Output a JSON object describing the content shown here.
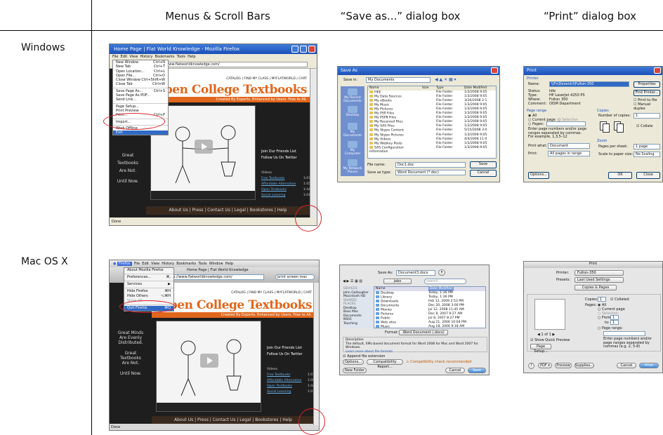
{
  "columns": {
    "menus": "Menus & Scroll Bars",
    "save": "“Save as...” dialog box",
    "print": "“Print” dialog box"
  },
  "rows": {
    "windows": "Windows",
    "mac": "Mac OS X"
  },
  "win_firefox": {
    "title": "Home Page | Flat World Knowledge - Mozilla Firefox",
    "menubar": [
      "File",
      "Edit",
      "View",
      "History",
      "Bookmarks",
      "Tools",
      "Help"
    ],
    "url": "http://www.flatworldknowledge.com/",
    "file_menu": [
      {
        "label": "New Window",
        "key": "Ctrl+N"
      },
      {
        "label": "New Tab",
        "key": "Ctrl+T"
      },
      {
        "label": "Open Location...",
        "key": "Ctrl+L"
      },
      {
        "label": "Open File...",
        "key": "Ctrl+O"
      },
      {
        "label": "Close Window",
        "key": "Ctrl+Shift+W"
      },
      {
        "label": "Close Tab",
        "key": "Ctrl+W"
      },
      {
        "label": "Save Page As...",
        "key": "Ctrl+S"
      },
      {
        "label": "Save Page As PDF...",
        "key": ""
      },
      {
        "label": "Send Link...",
        "key": ""
      },
      {
        "label": "Page Setup...",
        "key": ""
      },
      {
        "label": "Print Preview",
        "key": ""
      },
      {
        "label": "Print...",
        "key": "Ctrl+P"
      },
      {
        "label": "Import...",
        "key": ""
      },
      {
        "label": "Work Offline",
        "key": ""
      },
      {
        "label": "Exit",
        "key": ""
      }
    ],
    "nav_links": "CATALOG | FIND MY CLASS | MYFLATWORLD | CART",
    "site_title": "Open College Textbooks",
    "tagline": "Created By Experts. Enhanced by Users. Free to All.",
    "left_text": [
      "Great",
      "Textbooks",
      "Are Not.",
      "Until Now."
    ],
    "friends": [
      "Join Our Friends List",
      "Follow Us On Twitter"
    ],
    "videos_heading": "Videos",
    "videos": [
      {
        "title": "Free Textbooks",
        "time": "1:07"
      },
      {
        "title": "Affordable Alternative",
        "time": "1:05"
      },
      {
        "title": "Open Textbooks",
        "time": "1:44"
      },
      {
        "title": "Social Learning",
        "time": "1:01"
      }
    ],
    "footer": "About Us | Press | Contact Us | Legal | Bookstores | Help",
    "status": "Done"
  },
  "win_save": {
    "title": "Save As",
    "save_in_label": "Save in:",
    "save_in_value": "My Documents",
    "places": [
      "My Recent Documents",
      "Desktop",
      "My Documents",
      "My Computer",
      "My Network Places"
    ],
    "headers": [
      "Name",
      "Size",
      "Type",
      "Date Modified"
    ],
    "files": [
      {
        "name": "HKE",
        "type": "File Folder",
        "date": "1/3/2008 9:05"
      },
      {
        "name": "My Data Sources",
        "type": "File Folder",
        "date": "1/3/2008 9:05"
      },
      {
        "name": "My eBooks",
        "type": "File Folder",
        "date": "3/16/2008 2:1"
      },
      {
        "name": "My Music",
        "type": "File Folder",
        "date": "1/3/2008 9:05"
      },
      {
        "name": "My Pictures",
        "type": "File Folder",
        "date": "1/3/2008 9:05"
      },
      {
        "name": "My PSP Files",
        "type": "File Folder",
        "date": "1/3/2008 9:05"
      },
      {
        "name": "My PSP8 Files",
        "type": "File Folder",
        "date": "1/3/2008 9:05"
      },
      {
        "name": "My Received Files",
        "type": "File Folder",
        "date": "1/3/2008 9:05"
      },
      {
        "name": "My SAS Files",
        "type": "File Folder",
        "date": "1/3/2008 9:05"
      },
      {
        "name": "My Skype Content",
        "type": "File Folder",
        "date": "5/15/2008 3:0"
      },
      {
        "name": "My Skype Pictures",
        "type": "File Folder",
        "date": "1/3/2008 9:05"
      },
      {
        "name": "My Videos",
        "type": "File Folder",
        "date": "4/4/2008 11:0"
      },
      {
        "name": "My Webkey Posts",
        "type": "File Folder",
        "date": "1/3/2008 9:05"
      },
      {
        "name": "SAS Configuration Information",
        "type": "File Folder",
        "date": "1/3/2008 9:05"
      }
    ],
    "file_name_label": "File name:",
    "file_name_value": "Doc1.doc",
    "save_type_label": "Save as type:",
    "save_type_value": "Word Document (*.doc)",
    "save_btn": "Save",
    "cancel_btn": "Cancel"
  },
  "win_print": {
    "title": "Print",
    "printer_group": "Printer",
    "name_label": "Name:",
    "name_value": "\\\\Fs\\Deventri\\Fulton-350",
    "status_label": "Status:",
    "status_value": "Idle",
    "type_label": "Type:",
    "type_value": "HP LaserJet 4250 PS",
    "where_label": "Where:",
    "where_value": "Fulton 350",
    "comment_label": "Comment:",
    "comment_value": "OISM Department",
    "properties_btn": "Properties",
    "find_printer_btn": "Find Printer...",
    "print_to_file": "Print to file",
    "manual_duplex": "Manual duplex",
    "page_range": "Page range",
    "all": "All",
    "current_page": "Current page",
    "selection": "Selection",
    "pages": "Pages:",
    "range_hint": "Enter page numbers and/or page ranges separated by commas. For example, 1,3,5–12",
    "copies_group": "Copies",
    "num_copies_label": "Number of copies:",
    "num_copies_value": "1",
    "collate": "Collate",
    "print_what_label": "Print what:",
    "print_what_value": "Document",
    "print_label": "Print:",
    "print_value": "All pages in range",
    "zoom_group": "Zoom",
    "pages_per_sheet_label": "Pages per sheet:",
    "pages_per_sheet_value": "1 page",
    "scale_label": "Scale to paper size:",
    "scale_value": "No Scaling",
    "options_btn": "Options...",
    "ok_btn": "OK",
    "close_btn": "Close"
  },
  "mac_firefox": {
    "app_menu": [
      "Firefox",
      "File",
      "Edit",
      "View",
      "History",
      "Bookmarks",
      "Tools",
      "Window",
      "Help"
    ],
    "window_title": "Home Page | Flat World Knowledge",
    "url": "http://www.flatworldknowledge.com/",
    "search": "print screen mac",
    "dropdown": [
      {
        "label": "About Mozilla Firefox",
        "key": ""
      },
      {
        "label": "Preferences...",
        "key": "⌘,"
      },
      {
        "label": "Services",
        "key": "▶"
      },
      {
        "label": "Hide Firefox",
        "key": "⌘H"
      },
      {
        "label": "Hide Others",
        "key": "⌥⌘H"
      },
      {
        "label": "Show All",
        "key": ""
      },
      {
        "label": "Quit Firefox",
        "key": "⌘Q"
      }
    ],
    "nav_links": "CATALOG | FIND MY CLASS | MYFLATWORLD | CART",
    "site_title": "Open College Textbooks",
    "tagline": "Created By Experts. Enhanced by Users. Free to All.",
    "left_text": [
      "Great Minds",
      "Are Evenly",
      "Distributed.",
      "Great",
      "Textbooks",
      "Are Not.",
      "Until Now."
    ],
    "friends": [
      "Join Our Friends List",
      "Follow Us On Twitter"
    ],
    "videos_heading": "Videos",
    "videos": [
      {
        "title": "Free Textbooks",
        "time": "1:07"
      },
      {
        "title": "Affordable Alternative",
        "time": "1:05"
      },
      {
        "title": "Open Textbooks",
        "time": "1:44"
      },
      {
        "title": "Social Learning",
        "time": "1:01"
      }
    ],
    "footer": "About Us | Press | Contact Us | Legal | Bookstores | Help",
    "status": "Done"
  },
  "mac_save": {
    "save_as_label": "Save As:",
    "save_as_value": "Document3.docx",
    "location": "jabo",
    "search_placeholder": "search",
    "sidebar": [
      {
        "section": "DEVICES",
        "items": [
          "John Gallaugher",
          "Macintosh HD"
        ]
      },
      {
        "section": "SHARED",
        "items": []
      },
      {
        "section": "PLACES",
        "items": [
          "Desktop",
          "Bass Mac Documents",
          "NS01",
          "Teaching"
        ]
      }
    ],
    "headers": [
      "Name",
      "Date Modified"
    ],
    "files": [
      {
        "name": "Desktop",
        "date": "Today, 1:36 PM"
      },
      {
        "name": "Library",
        "date": "Today, 1:36 PM"
      },
      {
        "name": "Downloads",
        "date": "Feb 12, 2009 2:53 PM"
      },
      {
        "name": "Documents",
        "date": "Dec 20, 2008 3:00 PM"
      },
      {
        "name": "Movies",
        "date": "Jul 12, 2008 11:45 AM"
      },
      {
        "name": "Pictures",
        "date": "Dec 8, 2007 9:27 AM"
      },
      {
        "name": "Public",
        "date": "Jul 8, 2007 8:27 PM"
      },
      {
        "name": "Web sites",
        "date": "Aug 21, 2006 10:04 PM"
      },
      {
        "name": "Music",
        "date": "Aug 18, 2006 9:18 AM"
      }
    ],
    "format_label": "Format:",
    "format_value": "Word Document (.docx)",
    "description_label": "Description",
    "description_text": "The default, XML-based document format for Word 2008 for Mac and Word 2007 for Windows.",
    "learn_more": "Learn more about file formats",
    "append_ext": "Append file extension",
    "options_btn": "Options...",
    "compat_btn": "Compatibility Report...",
    "compat_note": "Compatibility check recommended",
    "new_folder_btn": "New Folder",
    "cancel_btn": "Cancel",
    "save_btn": "Save"
  },
  "mac_print": {
    "title": "Print",
    "printer_label": "Printer:",
    "printer_value": "Fulton-350",
    "presets_label": "Presets:",
    "presets_value": "Last Used Settings",
    "pane": "Copies & Pages",
    "copies_label": "Copies:",
    "copies_value": "1",
    "collated": "Collated",
    "pages_label": "Pages:",
    "all": "All",
    "current_page": "Current page",
    "selection": "Selection",
    "from": "From:",
    "from_value": "1",
    "to": "to:",
    "to_value": "1",
    "page_range": "Page range:",
    "range_hint": "Enter page numbers and/or page ranges separated by commas (e.g. 2, 5-8)",
    "page_count": "1 of 1",
    "show_preview": "Show Quick Preview",
    "page_setup": "Page Setup...",
    "help": "?",
    "pdf_btn": "PDF ▾",
    "preview_btn": "Preview",
    "supplies_btn": "Supplies...",
    "cancel_btn": "Cancel",
    "print_btn": "Print"
  },
  "colors": {
    "accent_orange": "#e0661c",
    "annotation_red": "#d8232a",
    "xp_blue": "#1c4fb8"
  }
}
